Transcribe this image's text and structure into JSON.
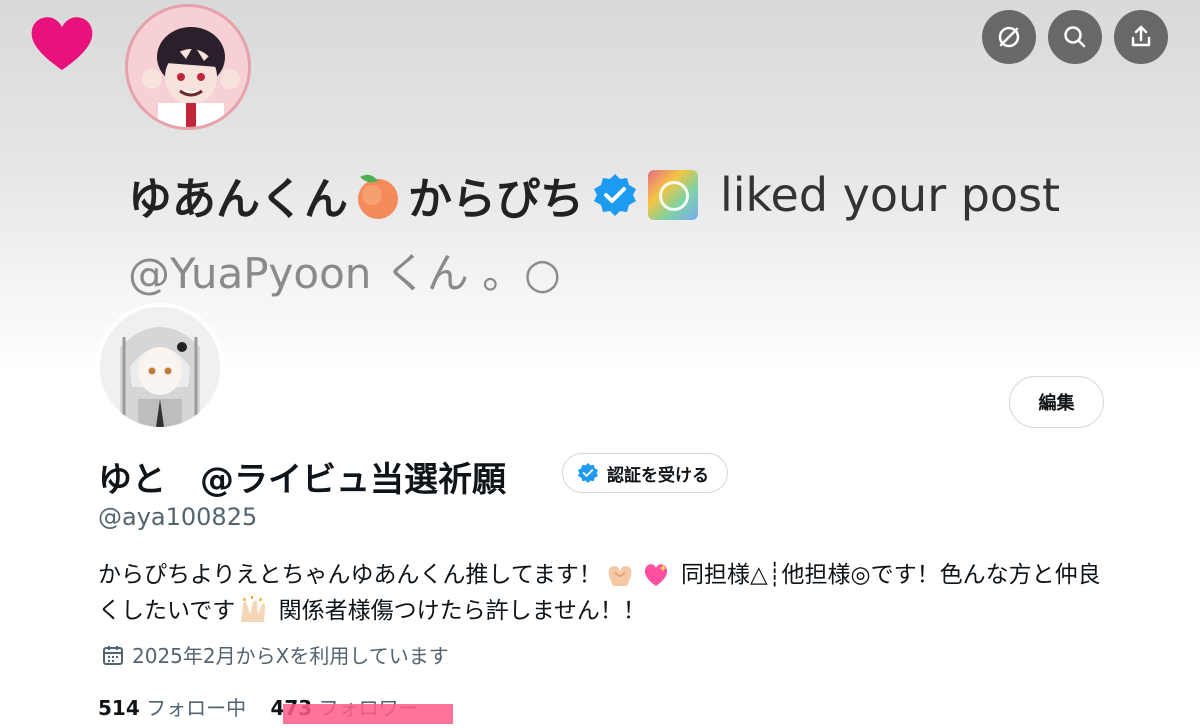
{
  "banner": {
    "notification_name": "ゆあんくん",
    "notification_name_suffix": "からぴち",
    "notification_action": "liked your post",
    "notification_handle": "@YuaPyoon くん 。○",
    "heart_icon": "heart-icon",
    "peach_icon": "peach-icon",
    "badge_icon": "verified-badge-icon"
  },
  "top_actions": [
    {
      "name": "hide-icon"
    },
    {
      "name": "search-icon"
    },
    {
      "name": "share-icon"
    }
  ],
  "profile": {
    "edit_label": "編集",
    "display_name": "ゆと　@ライビュ当選祈願",
    "verify_label": "認証を受ける",
    "handle": "@aya100825",
    "bio_part1": "からぴちよりえとちゃんゆあんくん推してます！",
    "bio_part2": "同担様△┊他担様◎です！色んな方と仲良くしたいです",
    "bio_part3": "関係者様傷つけたら許しません！！",
    "joined": "2025年2月からXを利用しています",
    "following_count": "514",
    "following_label": "フォロー中",
    "followers_count": "473",
    "followers_label": "フォロワー"
  },
  "colors": {
    "verified_blue": "#1d9bf0",
    "heart_pink": "#e8127c",
    "redaction": "#ff5c86"
  }
}
